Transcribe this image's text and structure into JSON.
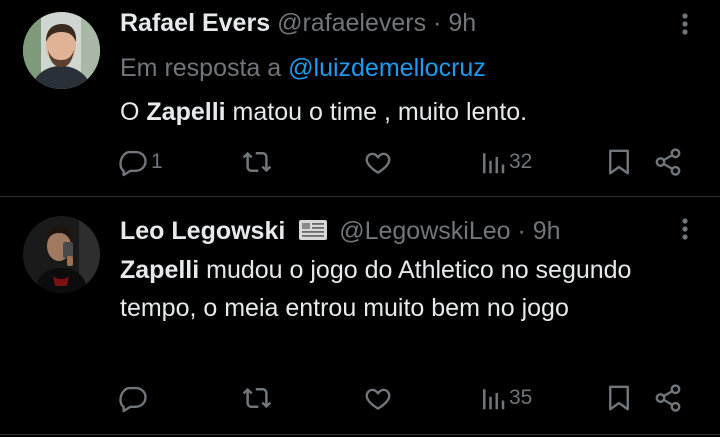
{
  "tweets": [
    {
      "display_name": "Rafael Evers",
      "handle": "@rafaelevers",
      "separator": "·",
      "time": "9h",
      "reply_prefix": "Em resposta a",
      "reply_mention": "@luizdemellocruz",
      "text_bold": "Zapelli",
      "text_before": "O ",
      "text_after": " matou o time , muito lento.",
      "reply_count": "1",
      "retweet_count": "",
      "like_count": "",
      "view_count": "32"
    },
    {
      "display_name": "Leo Legowski",
      "handle": "@LegowskiLeo",
      "separator": "·",
      "time": "9h",
      "text_bold": "Zapelli",
      "text_before": "",
      "text_after": " mudou o jogo do Athletico no segundo tempo, o meia entrou muito bem no jogo",
      "reply_count": "",
      "retweet_count": "",
      "like_count": "",
      "view_count": "35"
    }
  ],
  "icons": {
    "reply": "reply-icon",
    "retweet": "retweet-icon",
    "like": "heart-icon",
    "views": "views-icon",
    "bookmark": "bookmark-icon",
    "share": "share-icon",
    "more": "more-icon",
    "badge": "newspaper-icon"
  },
  "colors": {
    "background": "#000000",
    "text": "#e7e9ea",
    "muted": "#71767b",
    "link": "#1d9bf0",
    "divider": "#2f3336"
  }
}
